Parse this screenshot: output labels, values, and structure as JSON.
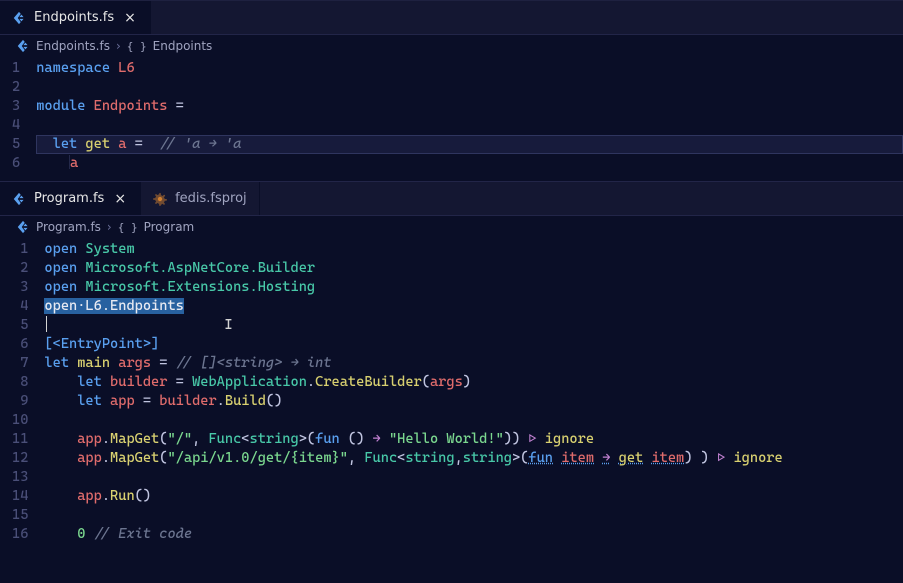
{
  "top": {
    "tab": {
      "label": "Endpoints.fs",
      "close": "×"
    },
    "breadcrumb": {
      "file": "Endpoints.fs",
      "sep": "›",
      "symbol": "Endpoints"
    },
    "tokens": {
      "namespace": "namespace",
      "L6": "L6",
      "module": "module",
      "Endpoints": "Endpoints",
      "eq": "=",
      "let": "let",
      "get": "get",
      "a": "a",
      "comment": "// 'a → 'a"
    }
  },
  "bottom": {
    "tabs": [
      {
        "label": "Program.fs",
        "close": "×",
        "active": true
      },
      {
        "label": "fedis.fsproj",
        "active": false
      }
    ],
    "breadcrumb": {
      "file": "Program.fs",
      "sep": "›",
      "symbol": "Program"
    },
    "tokens": {
      "open": "open",
      "System": "System",
      "MicrosoftAspNetCoreBuilder": "Microsoft.AspNetCore.Builder",
      "MicrosoftExtensionsHosting": "Microsoft.Extensions.Hosting",
      "L6Endpoints": "L6.Endpoints",
      "openSel": "open",
      "dotSel": "·",
      "EntryPoint": "[<EntryPoint>]",
      "let": "let",
      "main": "main",
      "args": "args",
      "eq": "=",
      "sigcmt": "// []<string> → int",
      "builder": "builder",
      "WebApplication": "WebApplication",
      "CreateBuilder": "CreateBuilder",
      "app": "app",
      "Build": "Build",
      "MapGet": "MapGet",
      "rootPath": "\"/\"",
      "Func": "Func",
      "string": "string",
      "fun": "fun",
      "unit": "()",
      "arrow": "→",
      "hello": "\"Hello World!\"",
      "pipe": "▷",
      "ignore": "ignore",
      "apiPath": "\"/api/v1.0/get/{item}\"",
      "item": "item",
      "get": "get",
      "Run": "Run",
      "zero": "0",
      "exitcmt": "// Exit code"
    }
  }
}
